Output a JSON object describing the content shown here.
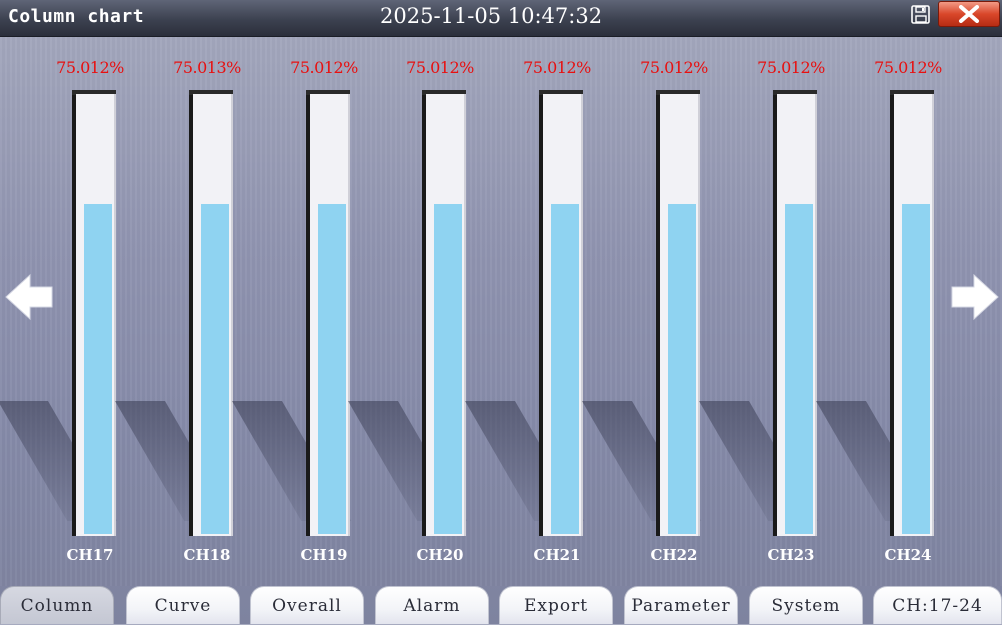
{
  "header": {
    "title": "Column chart",
    "datetime": "2025-11-05  10:47:32",
    "save_icon": "floppy-disk-icon",
    "close_icon": "close-x-icon"
  },
  "navigation": {
    "prev_icon": "arrow-left-icon",
    "next_icon": "arrow-right-icon"
  },
  "chart_data": {
    "type": "bar",
    "categories": [
      "CH17",
      "CH18",
      "CH19",
      "CH20",
      "CH21",
      "CH22",
      "CH23",
      "CH24"
    ],
    "value_labels": [
      "75.012%",
      "75.013%",
      "75.012%",
      "75.012%",
      "75.012%",
      "75.012%",
      "75.012%",
      "75.012%"
    ],
    "values": [
      75.012,
      75.013,
      75.012,
      75.012,
      75.012,
      75.012,
      75.012,
      75.012
    ],
    "ylim": [
      0,
      100
    ],
    "fill_color": "#8fd3f1",
    "label_color": "#e81010"
  },
  "tabs": [
    {
      "label": "Column",
      "active": true
    },
    {
      "label": "Curve",
      "active": false
    },
    {
      "label": "Overall",
      "active": false
    },
    {
      "label": "Alarm",
      "active": false
    },
    {
      "label": "Export",
      "active": false
    },
    {
      "label": "Parameter",
      "active": false
    },
    {
      "label": "System",
      "active": false
    },
    {
      "label": "CH:17-24",
      "active": false
    }
  ]
}
